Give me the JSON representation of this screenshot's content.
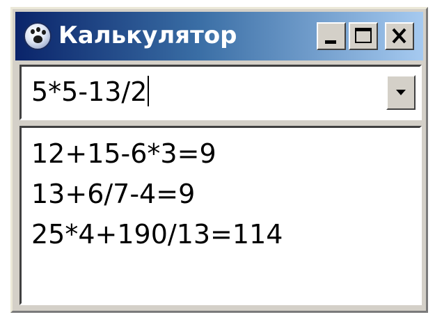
{
  "window": {
    "title": "Калькулятор",
    "icon": "paw-icon"
  },
  "title_buttons": {
    "minimize_icon": "minimize-icon",
    "maximize_icon": "maximize-icon",
    "close_icon": "close-icon"
  },
  "expression_combo": {
    "value": "5*5-13/2",
    "dropdown_icon": "chevron-down-icon"
  },
  "history": {
    "items": [
      "12+15-6*3=9",
      "13+6/7-4=9",
      "25*4+190/13=114"
    ]
  },
  "colors": {
    "title_gradient_start": "#0a246a",
    "title_gradient_end": "#a6caf0",
    "window_face": "#d4d0c8"
  }
}
